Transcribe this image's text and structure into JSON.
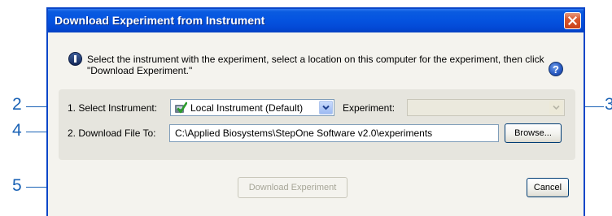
{
  "callouts": {
    "c2": "2",
    "c3": "3",
    "c4": "4",
    "c5": "5"
  },
  "dialog": {
    "title": "Download Experiment from Instrument",
    "instructions": "Select the instrument with the experiment, select a location on this computer for the experiment, then click \"Download Experiment.\"",
    "help_icon_text": "?",
    "select_instrument_label": "1. Select Instrument:",
    "instrument_value": "Local Instrument (Default)",
    "experiment_label": "Experiment:",
    "experiment_value": "",
    "download_to_label": "2. Download File To:",
    "download_path": "C:\\Applied Biosystems\\StepOne Software v2.0\\experiments",
    "browse_label": "Browse...",
    "download_button_label": "Download Experiment",
    "cancel_label": "Cancel"
  },
  "icons": {
    "close": "close-icon",
    "info": "info-icon",
    "help": "help-icon",
    "instrument": "instrument-icon",
    "dropdown": "chevron-down-icon"
  },
  "colors": {
    "titlebar": "#0554e0",
    "window_border": "#0a46c8",
    "close_button": "#d9572d",
    "callout": "#1a62b5",
    "panel": "#e6e5de",
    "dialog_bg": "#f4f3ee"
  }
}
